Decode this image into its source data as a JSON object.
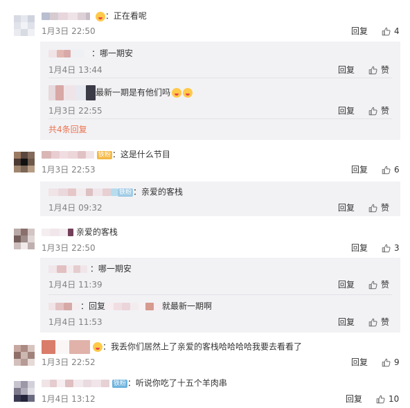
{
  "labels": {
    "reply": "回复",
    "like": "赞"
  },
  "comments": [
    {
      "text": "：正在看呢",
      "time": "1月3日 22:50",
      "likes": "4",
      "replies": [
        {
          "text": "：哪一期安",
          "time": "1月4日 13:44",
          "likes": "赞"
        },
        {
          "text": "最新一期是有他们吗",
          "time": "1月3日 22:55",
          "likes": "赞"
        }
      ],
      "more": "共4条回复"
    },
    {
      "text": "：这是什么节目",
      "time": "1月3日 22:53",
      "likes": "6",
      "badge": "铁粉",
      "replies": [
        {
          "text": "：亲爱的客栈",
          "time": "1月4日 09:32",
          "likes": "赞",
          "badge": "铁粉"
        }
      ]
    },
    {
      "text": "亲爱的客栈",
      "time": "1月3日 22:50",
      "likes": "3",
      "replies": [
        {
          "text": "：哪一期安",
          "time": "1月4日 11:39",
          "likes": "赞"
        },
        {
          "text_prefix": "：回复",
          "text": "就最新一期啊",
          "time": "1月4日 11:53",
          "likes": "赞"
        }
      ]
    },
    {
      "text": "：我丢你们居然上了亲爱的客栈哈哈哈哈我要去看看了",
      "time": "1月3日 22:52",
      "likes": "9"
    },
    {
      "text": "：听说你吃了十五个羊肉串",
      "time": "1月4日 13:12",
      "likes": "10",
      "badge": "铁粉"
    }
  ],
  "colors": {
    "accent": "#eb7350",
    "subbox_bg": "#f2f2f5",
    "time": "#808080"
  }
}
